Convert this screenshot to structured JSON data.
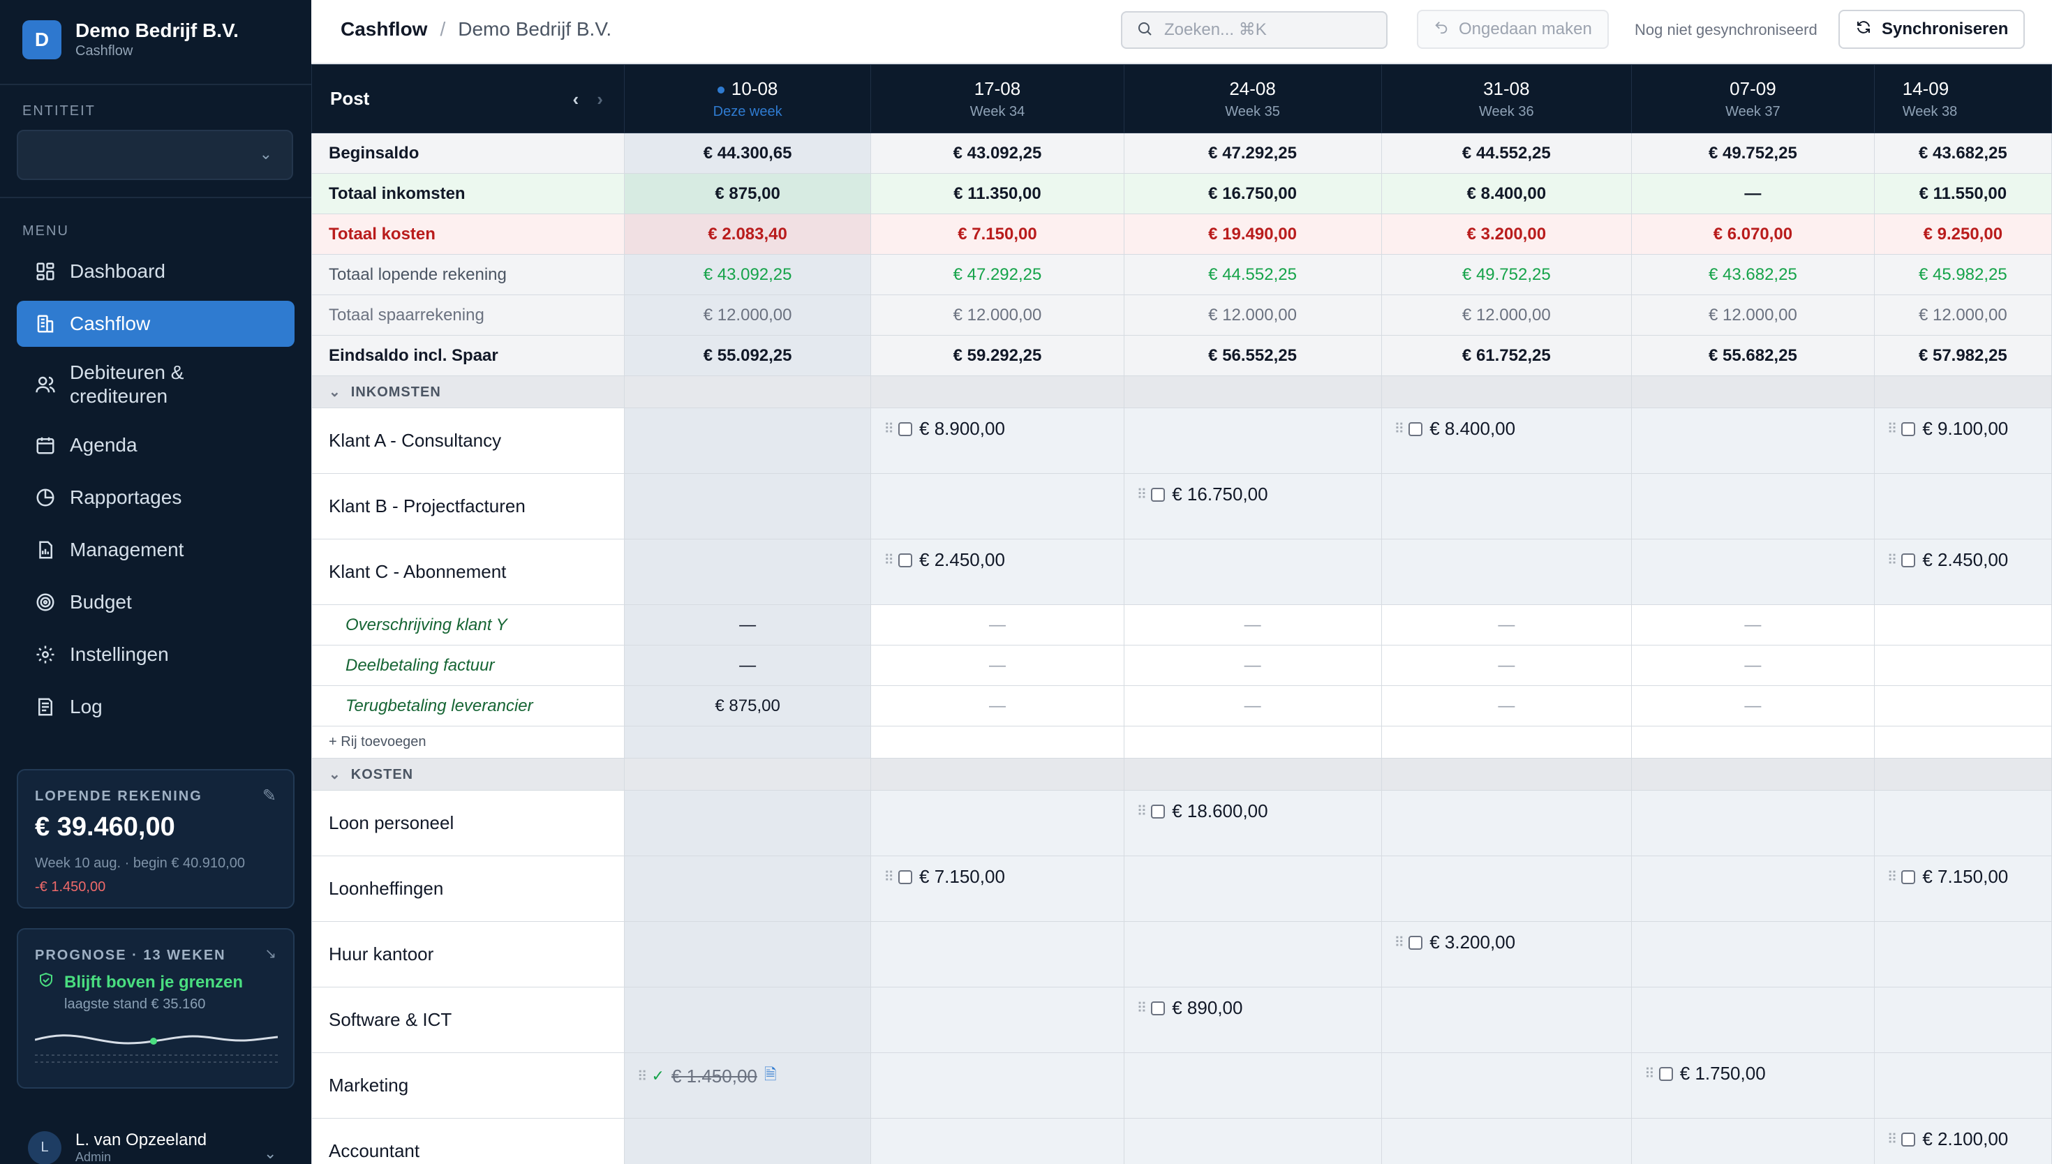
{
  "brand": {
    "initial": "D",
    "name": "Demo Bedrijf B.V.",
    "sub": "Cashflow"
  },
  "sidebar": {
    "entity_label": "ENTITEIT",
    "entity_value": "",
    "menu_label": "MENU",
    "items": [
      {
        "label": "Dashboard",
        "icon": "grid-icon"
      },
      {
        "label": "Cashflow",
        "icon": "building-icon",
        "active": true
      },
      {
        "label": "Debiteuren & crediteuren",
        "icon": "users-icon"
      },
      {
        "label": "Agenda",
        "icon": "calendar-icon"
      },
      {
        "label": "Rapportages",
        "icon": "pie-chart-icon"
      },
      {
        "label": "Management",
        "icon": "document-icon"
      },
      {
        "label": "Budget",
        "icon": "target-icon"
      },
      {
        "label": "Instellingen",
        "icon": "gear-icon"
      },
      {
        "label": "Log",
        "icon": "log-icon"
      }
    ],
    "account": {
      "label": "LOPENDE REKENING",
      "balance": "€ 39.460,00",
      "sub": "Week 10 aug. · begin € 40.910,00",
      "delta": "-€ 1.450,00"
    },
    "forecast": {
      "label": "PROGNOSE · 13 WEKEN",
      "status": "Blijft boven je grenzen",
      "sub": "laagste stand € 35.160"
    },
    "user": {
      "initial": "L",
      "name": "L. van Opzeeland",
      "role": "Admin"
    }
  },
  "header": {
    "title": "Cashflow",
    "entity": "Demo Bedrijf B.V.",
    "search_placeholder": "Zoeken... ⌘K",
    "undo_label": "Ongedaan maken",
    "sync_status": "Nog niet gesynchroniseerd",
    "sync_label": "Synchroniseren"
  },
  "table": {
    "post_label": "Post",
    "weeks": [
      {
        "date": "10-08",
        "week": "Deze week"
      },
      {
        "date": "17-08",
        "week": "Week 34"
      },
      {
        "date": "24-08",
        "week": "Week 35"
      },
      {
        "date": "31-08",
        "week": "Week 36"
      },
      {
        "date": "07-09",
        "week": "Week 37"
      },
      {
        "date": "14-09",
        "week": "Week 38"
      }
    ],
    "summary": [
      {
        "label": "Beginsaldo",
        "values": [
          "€ 44.300,65",
          "€ 43.092,25",
          "€ 47.292,25",
          "€ 44.552,25",
          "€ 49.752,25",
          "€ 43.682,25"
        ]
      },
      {
        "label": "Totaal inkomsten",
        "values": [
          "€ 875,00",
          "€ 11.350,00",
          "€ 16.750,00",
          "€ 8.400,00",
          "—",
          "€ 11.550,00"
        ]
      },
      {
        "label": "Totaal kosten",
        "values": [
          "€ 2.083,40",
          "€ 7.150,00",
          "€ 19.490,00",
          "€ 3.200,00",
          "€ 6.070,00",
          "€ 9.250,00"
        ]
      },
      {
        "label": "Totaal lopende rekening",
        "values": [
          "€ 43.092,25",
          "€ 47.292,25",
          "€ 44.552,25",
          "€ 49.752,25",
          "€ 43.682,25",
          "€ 45.982,25"
        ]
      },
      {
        "label": "Totaal spaarrekening",
        "values": [
          "€ 12.000,00",
          "€ 12.000,00",
          "€ 12.000,00",
          "€ 12.000,00",
          "€ 12.000,00",
          "€ 12.000,00"
        ]
      },
      {
        "label": "Eindsaldo incl. Spaar",
        "values": [
          "€ 55.092,25",
          "€ 59.292,25",
          "€ 56.552,25",
          "€ 61.752,25",
          "€ 55.682,25",
          "€ 57.982,25"
        ]
      }
    ],
    "income_label": "INKOMSTEN",
    "income": [
      {
        "label": "Klant A - Consultancy",
        "values": [
          "",
          "€ 8.900,00",
          "",
          "€ 8.400,00",
          "",
          "€ 9.100,00"
        ]
      },
      {
        "label": "Klant B - Projectfacturen",
        "values": [
          "",
          "",
          "€ 16.750,00",
          "",
          "",
          ""
        ]
      },
      {
        "label": "Klant C - Abonnement",
        "values": [
          "",
          "€ 2.450,00",
          "",
          "",
          "",
          "€ 2.450,00"
        ]
      }
    ],
    "income_sub": [
      {
        "label": "Overschrijving klant Y",
        "values": [
          "—",
          "—",
          "—",
          "—",
          "—",
          ""
        ]
      },
      {
        "label": "Deelbetaling factuur",
        "values": [
          "—",
          "—",
          "—",
          "—",
          "—",
          ""
        ]
      },
      {
        "label": "Terugbetaling leverancier",
        "values": [
          "€ 875,00",
          "—",
          "—",
          "—",
          "—",
          ""
        ]
      }
    ],
    "add_row_label": "Rij toevoegen",
    "costs_label": "KOSTEN",
    "costs": [
      {
        "label": "Loon personeel",
        "values": [
          "",
          "",
          "€ 18.600,00",
          "",
          "",
          ""
        ]
      },
      {
        "label": "Loonheffingen",
        "values": [
          "",
          "€ 7.150,00",
          "",
          "",
          "",
          "€ 7.150,00"
        ]
      },
      {
        "label": "Huur kantoor",
        "values": [
          "",
          "",
          "",
          "€ 3.200,00",
          "",
          ""
        ]
      },
      {
        "label": "Software & ICT",
        "values": [
          "",
          "",
          "€ 890,00",
          "",
          "",
          ""
        ]
      },
      {
        "label": "Marketing",
        "values": [
          "€ 1.450,00",
          "",
          "",
          "",
          "€ 1.750,00",
          ""
        ],
        "paid": [
          true,
          false,
          false,
          false,
          false,
          false
        ]
      },
      {
        "label": "Accountant",
        "values": [
          "",
          "",
          "",
          "",
          "",
          "€ 2.100,00"
        ]
      }
    ]
  },
  "colors": {
    "sidebar_bg": "#0c1a2b",
    "accent": "#2f7bd0",
    "positive": "#16a34a",
    "negative": "#b91c1c"
  }
}
